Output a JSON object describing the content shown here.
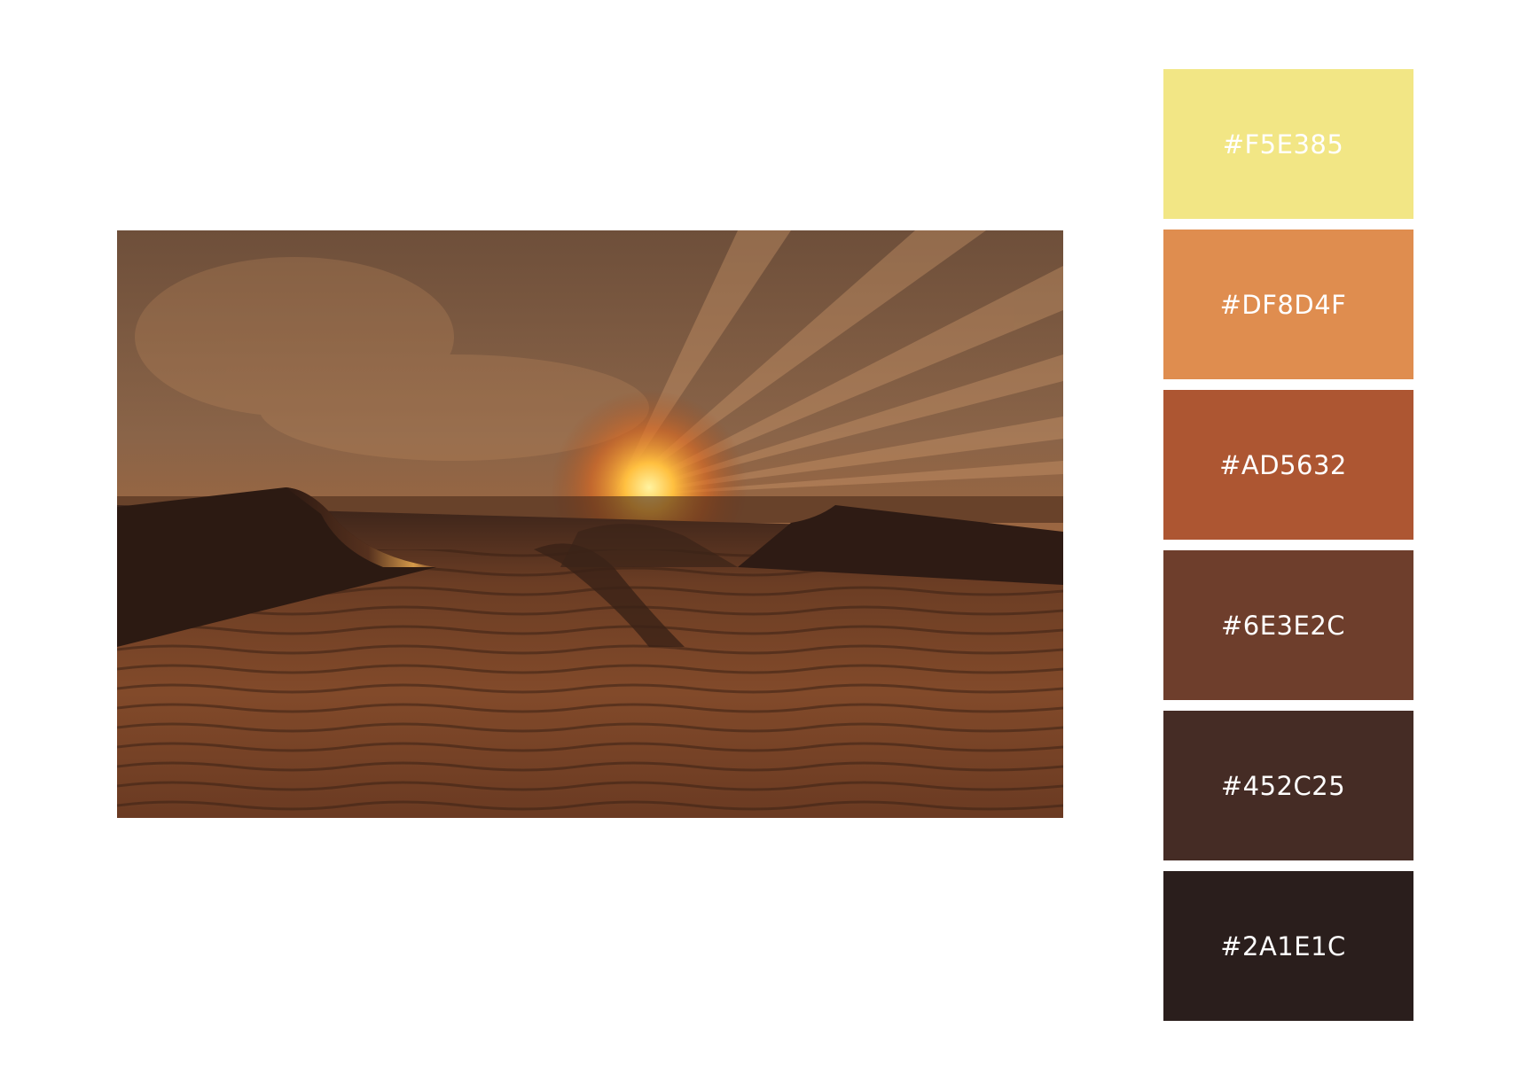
{
  "photo": {
    "description_icon": "desert-sunset-photo"
  },
  "palette": {
    "swatches": [
      {
        "label": "#F5E385",
        "color": "#F2E685"
      },
      {
        "label": "#DF8D4F",
        "color": "#DF8D4F"
      },
      {
        "label": "#AD5632",
        "color": "#AD5632"
      },
      {
        "label": "#6E3E2C",
        "color": "#6E3E2C"
      },
      {
        "label": "#452C25",
        "color": "#452C25"
      },
      {
        "label": "#2A1E1C",
        "color": "#2A1E1C"
      }
    ]
  }
}
